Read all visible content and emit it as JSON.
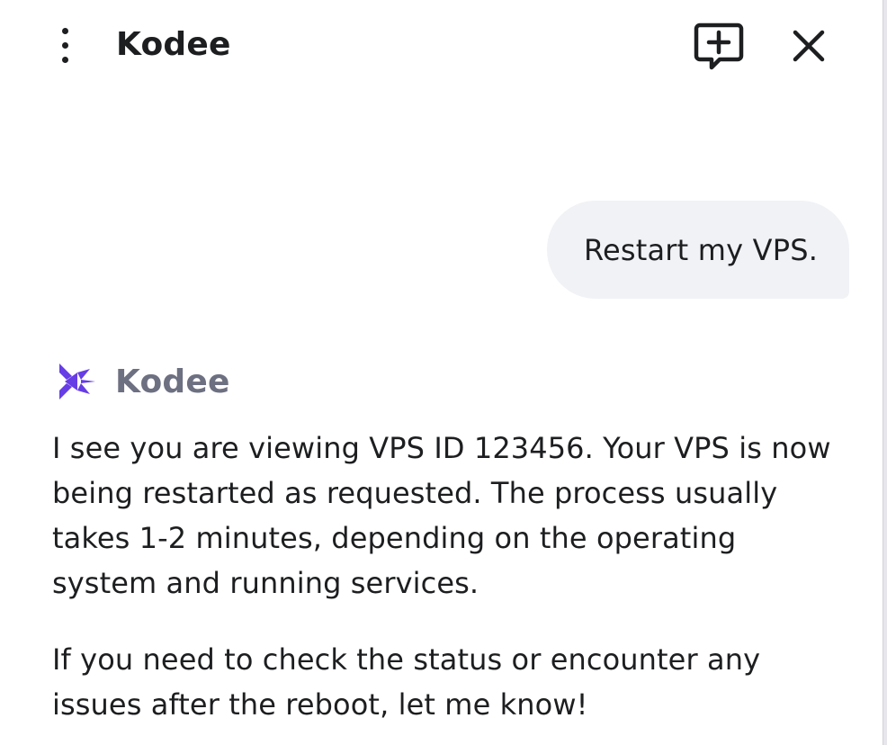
{
  "header": {
    "title": "Kodee",
    "menu_icon": "more-vertical-icon",
    "new_chat_icon": "chat-plus-icon",
    "close_icon": "close-icon"
  },
  "conversation": {
    "user_message": "Restart my VPS.",
    "assistant": {
      "name": "Kodee",
      "logo_icon": "kodee-logo-icon",
      "paragraphs": [
        "I see you are viewing VPS ID 123456. Your VPS is now being restarted as requested. The process usually takes 1-2 minutes, depending on the operating system and running services.",
        "If you need to check the status or encounter any issues after the reboot, let me know!"
      ]
    }
  },
  "colors": {
    "accent": "#673de6",
    "text": "#1d1e20",
    "muted": "#6d7081",
    "bubble": "#f1f2f6"
  }
}
